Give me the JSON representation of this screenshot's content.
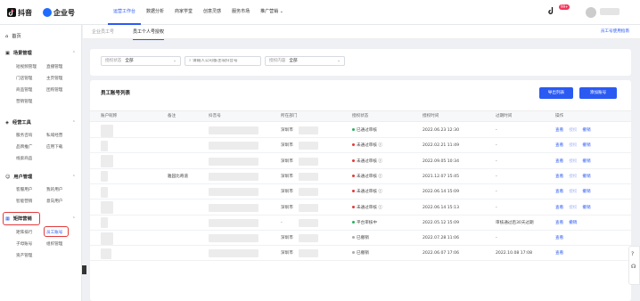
{
  "brand": {
    "douyin": "抖音",
    "enterprise": "企业号"
  },
  "nav": {
    "items": [
      "运营工作台",
      "数据分析",
      "商家学堂",
      "创意灵感",
      "服务市场",
      "推广营销"
    ],
    "active": 0
  },
  "header": {
    "notif_badge": "99+"
  },
  "sidebar": {
    "home": "首页",
    "scene": {
      "title": "场景管理",
      "items": [
        "短视频管理",
        "直播管理",
        "门店管理",
        "主页管理",
        "商品管理",
        "团购管理",
        "营销管理"
      ]
    },
    "ops": {
      "title": "经营工具",
      "items": [
        "服务咨询",
        "私域经营",
        "品牌推广",
        "应用下载",
        "线索商品"
      ]
    },
    "user": {
      "title": "用户管理",
      "items": [
        "客服用户",
        "我的用户",
        "智能营销",
        "意向用户"
      ]
    },
    "matrix": {
      "title": "矩阵营销",
      "items": [
        "矩阵排行",
        "员工账号",
        "子母账号",
        "组织管理",
        "资产管理"
      ]
    }
  },
  "tabs": {
    "items": [
      "企业员工号",
      "员工个人号授权"
    ],
    "active": 1,
    "help": "员工号使用指南"
  },
  "filters": {
    "auth_status": {
      "label": "授权状态",
      "value": "全部"
    },
    "search": {
      "placeholder": "请输入公司备注或抖音号"
    },
    "auth_content": {
      "label": "授权内容",
      "value": "全部"
    }
  },
  "list": {
    "title": "员工账号列表",
    "export_label": "导出列表",
    "add_label": "添加账号",
    "columns": [
      "账户昵称",
      "备注",
      "抖音号",
      "所在部门",
      "授权状态",
      "授权时间",
      "过期时间",
      "操作"
    ],
    "rows": [
      {
        "note": "",
        "dept": "深圳市",
        "status": "已通过审核",
        "status_color": "#27b15b",
        "auth_time": "2022.06.23 12:30",
        "expire": "-",
        "ops": [
          "查看",
          "授权",
          "撤销"
        ],
        "disabled_op": 1
      },
      {
        "note": "",
        "dept": "深圳市",
        "status": "未通过审核 ⓘ",
        "status_color": "#e23b3b",
        "auth_time": "2022.02.21 11:49",
        "expire": "-",
        "ops": [
          "查看",
          "授权",
          "撤销"
        ],
        "disabled_op": 1
      },
      {
        "note": "",
        "dept": "深圳市",
        "status": "未通过审核 ⓘ",
        "status_color": "#e23b3b",
        "auth_time": "2022.09.05 10:34",
        "expire": "-",
        "ops": [
          "查看",
          "授权",
          "撤销"
        ],
        "disabled_op": 1
      },
      {
        "note": "雅园比奇道",
        "dept": "深圳市",
        "status": "未通过审核 ⓘ",
        "status_color": "#e23b3b",
        "auth_time": "2021.12.07 15:45",
        "expire": "-",
        "ops": [
          "查看",
          "授权",
          "撤销"
        ],
        "disabled_op": 1
      },
      {
        "note": "",
        "dept": "深圳市",
        "status": "未通过审核 ⓘ",
        "status_color": "#e23b3b",
        "auth_time": "2022.06.14 15:09",
        "expire": "-",
        "ops": [
          "查看",
          "授权",
          "撤销"
        ],
        "disabled_op": 1
      },
      {
        "note": "",
        "dept": "深圳市",
        "status": "未通过审核 ⓘ",
        "status_color": "#e23b3b",
        "auth_time": "2022.06.14 15:13",
        "expire": "-",
        "ops": [
          "查看",
          "授权",
          "撤销"
        ],
        "disabled_op": 1
      },
      {
        "note": "",
        "dept": "-",
        "status": "平台审核中",
        "status_color": "#27b15b",
        "auth_time": "2022.05.12 15:09",
        "expire": "审核通过后30天过期",
        "ops": [
          "查看",
          "撤销"
        ],
        "disabled_op": -1
      },
      {
        "note": "",
        "dept": "深圳市",
        "status": "已撤销",
        "status_color": "#aaaaaa",
        "auth_time": "2022.07.28 11:06",
        "expire": "-",
        "ops": [
          "查看"
        ],
        "disabled_op": -1
      },
      {
        "note": "",
        "dept": "深圳市",
        "status": "已撤销",
        "status_color": "#aaaaaa",
        "auth_time": "2022.06.07 17:06",
        "expire": "2022.10.08 17:08",
        "ops": [
          "查看"
        ],
        "disabled_op": -1
      }
    ]
  },
  "colors": {
    "accent": "#2b5af2",
    "highlight": "#e23b3b"
  }
}
